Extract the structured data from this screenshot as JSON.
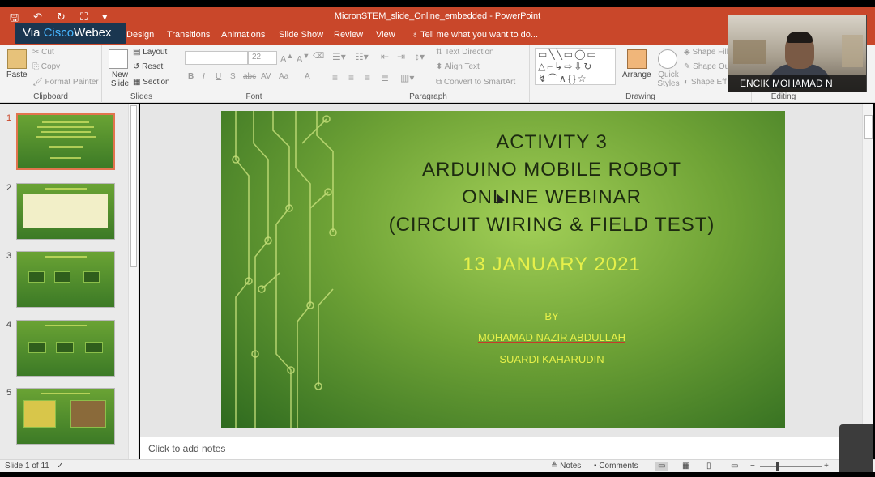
{
  "app": {
    "window_title": "MicronSTEM_slide_Online_embedded - PowerPoint",
    "via_prefix": "Via ",
    "via_brand": "Cisco",
    "via_suffix": "Webex"
  },
  "ribbon_tabs": [
    "Design",
    "Transitions",
    "Animations",
    "Slide Show",
    "Review",
    "View",
    "Tell me what you want to do..."
  ],
  "clipboard": {
    "paste": "Paste",
    "cut": "Cut",
    "copy": "Copy",
    "format_painter": "Format Painter",
    "label": "Clipboard"
  },
  "slides_group": {
    "new_slide": "New Slide",
    "layout": "Layout",
    "reset": "Reset",
    "section": "Section",
    "label": "Slides"
  },
  "font_group": {
    "size": "22",
    "label": "Font",
    "bold": "B",
    "italic": "I",
    "underline": "U",
    "shadow": "S",
    "strike": "abc",
    "spacing": "AV",
    "case": "Aa",
    "color": "A"
  },
  "paragraph_group": {
    "text_direction": "Text Direction",
    "align_text": "Align Text",
    "smartart": "Convert to SmartArt",
    "label": "Paragraph"
  },
  "drawing_group": {
    "arrange": "Arrange",
    "quick_styles": "Quick Styles",
    "shape_fill": "Shape Fill",
    "shape_outline": "Shape Out",
    "shape_effects": "Shape Eff",
    "label": "Drawing"
  },
  "editing_group": {
    "label": "Editing"
  },
  "thumbnails": [
    {
      "num": "1",
      "selected": true
    },
    {
      "num": "2",
      "selected": false
    },
    {
      "num": "3",
      "selected": false
    },
    {
      "num": "4",
      "selected": false
    },
    {
      "num": "5",
      "selected": false
    }
  ],
  "slide": {
    "line1": "ACTIVITY 3",
    "line2": "ARDUINO MOBILE ROBOT",
    "line3": "ONLINE WEBINAR",
    "line4": "(CIRCUIT WIRING & FIELD TEST)",
    "date": "13 JANUARY 2021",
    "by": "BY",
    "author1": "MOHAMAD NAZIR ABDULLAH",
    "author2": "SUARDI KAHARUDIN"
  },
  "notes_placeholder": "Click to add notes",
  "status": {
    "slide_counter": "Slide 1 of 11",
    "notes": "Notes",
    "comments": "Comments"
  },
  "video": {
    "participant_name": "ENCIK MOHAMAD N"
  },
  "colors": {
    "accent": "#c9472a",
    "slide_title": "#1d2a10",
    "slide_highlight": "#e6f04a"
  }
}
